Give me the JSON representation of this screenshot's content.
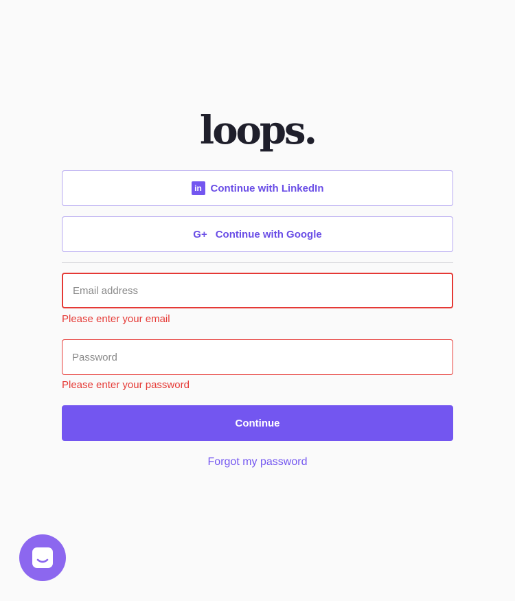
{
  "brand": {
    "logo_text": "loops."
  },
  "oauth": {
    "linkedin_label": "Continue with LinkedIn",
    "linkedin_icon": "in",
    "google_label": "Continue with Google",
    "google_icon": "G+"
  },
  "form": {
    "email": {
      "placeholder": "Email address",
      "value": "",
      "error": "Please enter your email"
    },
    "password": {
      "placeholder": "Password",
      "value": "",
      "error": "Please enter your password"
    },
    "continue_label": "Continue",
    "forgot_label": "Forgot my password"
  },
  "chat": {
    "icon": "chat-icon"
  },
  "colors": {
    "accent": "#7356f0",
    "error": "#e53935",
    "background": "#fafafa",
    "logo": "#1f1f2b",
    "chat": "#8c67ef"
  }
}
